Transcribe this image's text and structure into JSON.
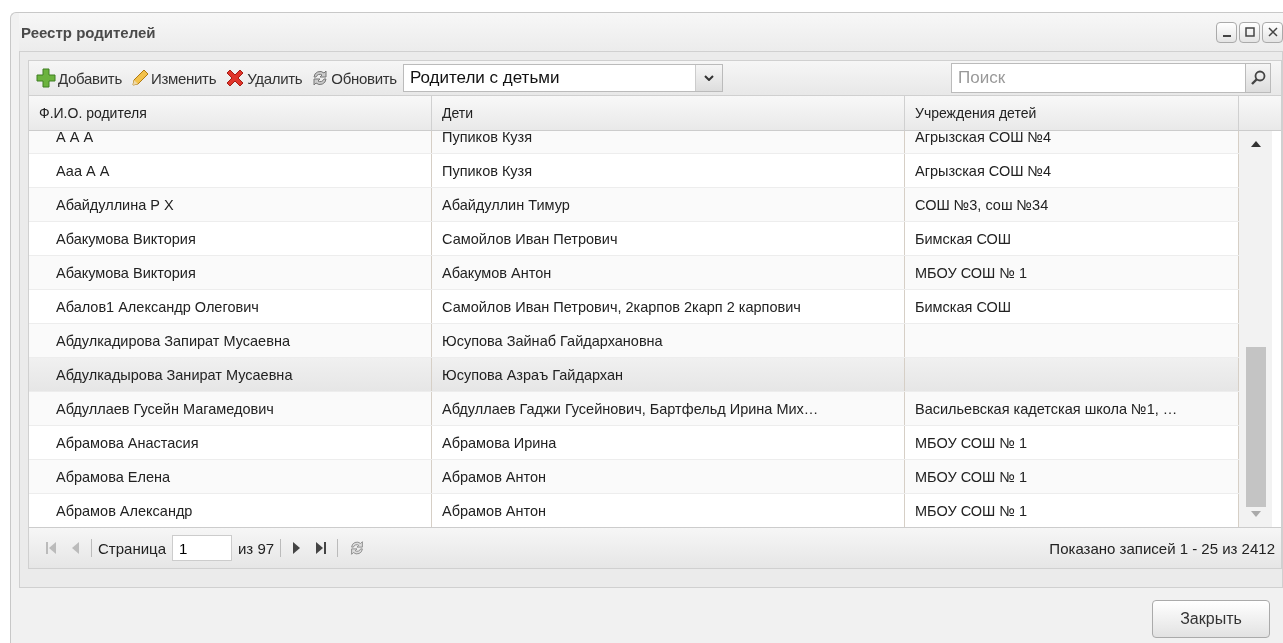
{
  "window": {
    "title": "Реестр родителей"
  },
  "toolbar": {
    "buttons": [
      {
        "kind": "add",
        "label": "Добавить"
      },
      {
        "kind": "edit",
        "label": "Изменить"
      },
      {
        "kind": "delete",
        "label": "Удалить"
      },
      {
        "kind": "refresh",
        "label": "Обновить"
      }
    ],
    "filter": {
      "value": "Родители с детьми"
    },
    "search": {
      "placeholder": "Поиск"
    }
  },
  "table": {
    "columns": [
      "Ф.И.О. родителя",
      "Дети",
      "Учреждения детей"
    ],
    "rows": [
      {
        "cells": [
          "А А А",
          "Пупиков Кузя",
          "Агрызская СОШ №4"
        ],
        "selected": false
      },
      {
        "cells": [
          "Ааа А А",
          "Пупиков Кузя",
          "Агрызская СОШ №4"
        ],
        "selected": false
      },
      {
        "cells": [
          "Абайдуллина Р Х",
          "Абайдуллин Тимур",
          "СОШ №3, сош №34"
        ],
        "selected": false
      },
      {
        "cells": [
          "Абакумова Виктория",
          "Самойлов Иван Петрович",
          "Бимская СОШ"
        ],
        "selected": false
      },
      {
        "cells": [
          "Абакумова Виктория",
          "Абакумов Антон",
          "МБОУ СОШ № 1"
        ],
        "selected": false
      },
      {
        "cells": [
          "Абалов1 Александр Олегович",
          "Самойлов Иван Петрович, 2карпов 2карп 2 карпович",
          "Бимская СОШ"
        ],
        "selected": false
      },
      {
        "cells": [
          "Абдулкадирова Запират Мусаевна",
          "Юсупова Зайнаб Гайдархановна",
          ""
        ],
        "selected": false
      },
      {
        "cells": [
          "Абдулкадырова Занират Мусаевна",
          "Юсупова Азраъ Гайдархан",
          ""
        ],
        "selected": true
      },
      {
        "cells": [
          "Абдуллаев Гусейн Магамедович",
          "Абдуллаев Гаджи Гусейнович, Бартфельд Ирина Мих…",
          "Васильевская кадетская школа №1, …"
        ],
        "selected": false
      },
      {
        "cells": [
          "Абрамова Анастасия",
          "Абрамова Ирина",
          "МБОУ СОШ № 1"
        ],
        "selected": false
      },
      {
        "cells": [
          "Абрамова Елена",
          "Абрамов Антон",
          "МБОУ СОШ № 1"
        ],
        "selected": false
      },
      {
        "cells": [
          "Абрамов Александр",
          "Абрамов Антон",
          "МБОУ СОШ № 1"
        ],
        "selected": false
      }
    ]
  },
  "pager": {
    "page_label": "Страница",
    "page": "1",
    "of_label": "из 97",
    "summary": "Показано записей 1 - 25 из 2412"
  },
  "buttons": [
    "Закрыть"
  ]
}
